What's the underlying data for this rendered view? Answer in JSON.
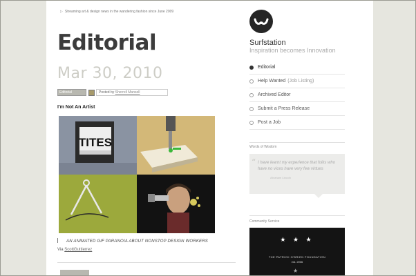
{
  "header": {
    "tagline": "Streaming art & design news in the wandering fashion since June 2009",
    "page_title": "Editorial",
    "date": "Mar 30, 2010"
  },
  "post": {
    "tag_label": "Editorial",
    "posted_by_prefix": "Posted by",
    "author": "Sherrell Mansell",
    "title": "I'm Not An Artist",
    "image_text": "TITES",
    "caption": "AN ANIMATED GIF PARANOIA ABOUT NONSTOP DESIGN WORKERS",
    "via_label": "Via",
    "via_link": "ScottGuttierrez"
  },
  "sidebar": {
    "site_name": "Surfstation",
    "site_tagline": "Inspiration becomes Innovation",
    "nav": [
      {
        "label": "Editorial",
        "extra": "",
        "active": true
      },
      {
        "label": "Help Wanted",
        "extra": "(Job Listing)",
        "active": false
      },
      {
        "label": "Archived Editor",
        "extra": "",
        "active": false
      },
      {
        "label": "Submit a Press Release",
        "extra": "",
        "active": false
      },
      {
        "label": "Post a Job",
        "extra": "",
        "active": false
      }
    ],
    "words_title": "Words of Wisdom",
    "quote_text": "I have learnt my experience that folks who have no vices have very few virtues",
    "quote_author": "Abraham Lincoln",
    "community_title": "Community Service",
    "promo_stars": "★ ★ ★",
    "promo_line1": "THE PATRICK O'BRIEN FOUNDATION",
    "promo_line2": "est. 2006"
  },
  "colors": {
    "background": "#e6e6df",
    "page": "#ffffff",
    "title": "#3c3c3c",
    "date": "#cdcdc6",
    "promo": "#141414"
  }
}
